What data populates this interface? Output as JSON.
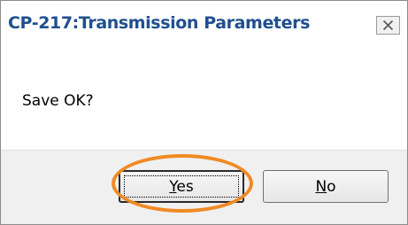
{
  "dialog": {
    "title": "CP-217:Transmission Parameters",
    "message": "Save OK?",
    "close_icon": "close-icon"
  },
  "buttons": {
    "yes": {
      "mnemonic": "Y",
      "rest": "es"
    },
    "no": {
      "mnemonic": "N",
      "rest": "o"
    }
  },
  "annotation": {
    "highlight_color": "#f08a24",
    "highlight_target": "yes-button"
  },
  "colors": {
    "title": "#1f4f8f",
    "footer_bg": "#f0f0f0"
  }
}
